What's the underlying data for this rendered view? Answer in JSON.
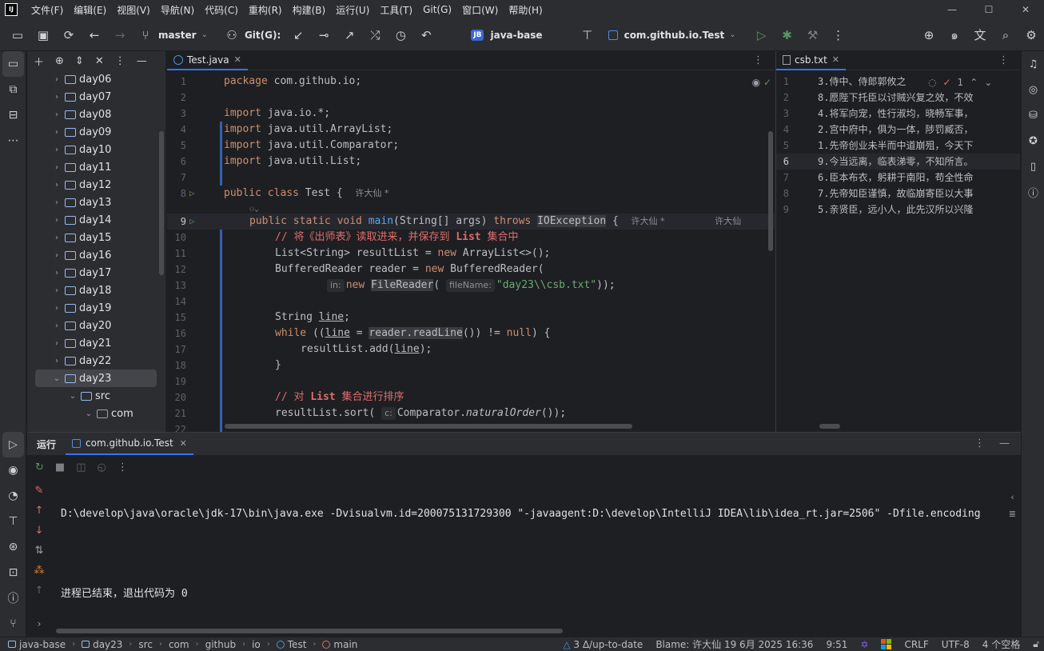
{
  "menu": [
    "文件(F)",
    "编辑(E)",
    "视图(V)",
    "导航(N)",
    "代码(C)",
    "重构(R)",
    "构建(B)",
    "运行(U)",
    "工具(T)",
    "Git(G)",
    "窗口(W)",
    "帮助(H)"
  ],
  "toolbar": {
    "branch": "master",
    "git_label": "Git(G):",
    "project_badge": "JB",
    "project": "java-base",
    "run_config": "com.github.io.Test"
  },
  "project_tree": {
    "items": [
      {
        "label": "day06"
      },
      {
        "label": "day07"
      },
      {
        "label": "day08"
      },
      {
        "label": "day09"
      },
      {
        "label": "day10"
      },
      {
        "label": "day11"
      },
      {
        "label": "day12"
      },
      {
        "label": "day13"
      },
      {
        "label": "day14"
      },
      {
        "label": "day15"
      },
      {
        "label": "day16"
      },
      {
        "label": "day17"
      },
      {
        "label": "day18"
      },
      {
        "label": "day19"
      },
      {
        "label": "day20"
      },
      {
        "label": "day21"
      },
      {
        "label": "day22"
      },
      {
        "label": "day23"
      },
      {
        "label": "src"
      },
      {
        "label": "com"
      }
    ]
  },
  "editor": {
    "tab": "Test.java",
    "author_hint_1": "许大仙 *",
    "author_hint_2": "许大仙 *",
    "author_hint_3": "许大仙",
    "param_hint_in": "in:",
    "param_hint_filename": "fileName:",
    "param_hint_c": "c:",
    "line_numbers": [
      "1",
      "2",
      "3",
      "4",
      "5",
      "6",
      "7",
      "8",
      "9",
      "10",
      "11",
      "12",
      "13",
      "14",
      "15",
      "16",
      "17",
      "18",
      "19",
      "20",
      "21",
      "22"
    ]
  },
  "txt_file": {
    "tab": "csb.txt",
    "problems_count": "1",
    "lines": [
      "3.侍中、侍郎郭攸之",
      "8.愿陛下托臣以讨贼兴复之效，不效",
      "4.将军向宠，性行淑均，晓畅军事，",
      "2.宫中府中，俱为一体，陟罚臧否，",
      "1.先帝创业未半而中道崩殂，今天下",
      "9.今当远离，临表涕零，不知所言。",
      "6.臣本布衣，躬耕于南阳，苟全性命",
      "7.先帝知臣谨慎，故临崩寄臣以大事",
      "5.亲贤臣，远小人，此先汉所以兴隆"
    ]
  },
  "run_panel": {
    "label": "运行",
    "tab": "com.github.io.Test",
    "console_line_1": "D:\\develop\\java\\oracle\\jdk-17\\bin\\java.exe -Dvisualvm.id=200075131729300 \"-javaagent:D:\\develop\\IntelliJ IDEA\\lib\\idea_rt.jar=2506\" -Dfile.encoding",
    "console_line_2": "进程已结束，退出代码为 0"
  },
  "statusbar": {
    "crumbs": [
      "java-base",
      "day23",
      "src",
      "com",
      "github",
      "io",
      "Test",
      "main"
    ],
    "vcs": "3 Δ/up-to-date",
    "blame": "Blame: 许大仙 19 6月 2025 16:36",
    "position": "9:51",
    "line_sep": "CRLF",
    "encoding": "UTF-8",
    "indent": "4 个空格"
  },
  "colors": {
    "accent": "#3574f0",
    "keyword": "#cf8e6d",
    "string": "#6aab73",
    "comment_red": "#e06c6c",
    "function": "#56a8f5"
  }
}
